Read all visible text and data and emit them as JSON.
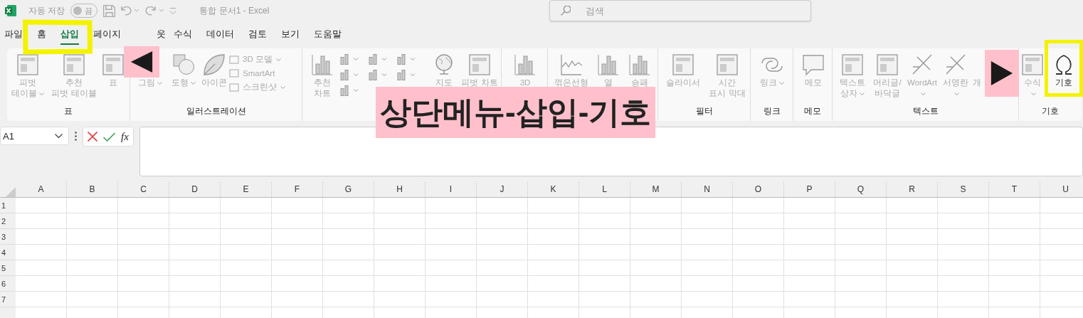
{
  "title_bar": {
    "autosave_label": "자동 저장",
    "autosave_toggle": {
      "label": "끔",
      "on": false
    },
    "document_title": "통합 문서1  -  Excel",
    "search": {
      "placeholder": "검색"
    }
  },
  "tabs": [
    {
      "label": "파일",
      "selected": false
    },
    {
      "label": "홈",
      "selected": false
    },
    {
      "label": "삽입",
      "selected": true
    },
    {
      "label": "페이지",
      "selected": false
    },
    {
      "label": "웃",
      "selected": false
    },
    {
      "label": "수식",
      "selected": false
    },
    {
      "label": "데이터",
      "selected": false
    },
    {
      "label": "검토",
      "selected": false
    },
    {
      "label": "보기",
      "selected": false
    },
    {
      "label": "도움말",
      "selected": false
    }
  ],
  "ribbon_groups": [
    {
      "label": "표",
      "items": [
        {
          "kind": "large",
          "label": "피벗\n테이블",
          "dropdown": true,
          "disabled": true
        },
        {
          "kind": "large",
          "label": "추천\n피벗 테이블",
          "dropdown": false,
          "disabled": true
        },
        {
          "kind": "large",
          "label": "표",
          "dropdown": false,
          "disabled": true
        }
      ]
    },
    {
      "label": "일러스트레이션",
      "items": [
        {
          "kind": "large",
          "label": "그림",
          "dropdown": true,
          "disabled": true
        },
        {
          "kind": "large",
          "label": "도형",
          "dropdown": true,
          "disabled": true
        },
        {
          "kind": "large",
          "label": "아이콘",
          "dropdown": false,
          "disabled": true
        },
        {
          "kind": "small",
          "label": "3D 모델",
          "dropdown": true,
          "disabled": true
        },
        {
          "kind": "small",
          "label": "SmartArt",
          "dropdown": false,
          "disabled": true
        },
        {
          "kind": "small",
          "label": "스크린샷",
          "dropdown": true,
          "disabled": true
        }
      ]
    },
    {
      "items": [
        {
          "kind": "large",
          "label": "추천\n차트",
          "dropdown": false,
          "disabled": true
        },
        {
          "kind": "chart-grid"
        },
        {
          "kind": "large",
          "label": "지도",
          "dropdown": false,
          "disabled": true
        },
        {
          "kind": "large",
          "label": "피벗 차트",
          "dropdown": false,
          "disabled": true
        }
      ]
    },
    {
      "items": [
        {
          "kind": "large",
          "label": "3D",
          "dropdown": false,
          "disabled": true
        }
      ]
    },
    {
      "items": [
        {
          "kind": "large",
          "label": "꺾은선형",
          "dropdown": false,
          "disabled": true
        },
        {
          "kind": "large",
          "label": "열",
          "dropdown": false,
          "disabled": true
        },
        {
          "kind": "large",
          "label": "승패",
          "dropdown": false,
          "disabled": true
        }
      ]
    },
    {
      "label": "필터",
      "items": [
        {
          "kind": "large",
          "label": "슬라이서",
          "dropdown": false,
          "disabled": true
        },
        {
          "kind": "large",
          "label": "시간\n표시 막대",
          "dropdown": false,
          "disabled": true
        }
      ]
    },
    {
      "label": "링크",
      "items": [
        {
          "kind": "large",
          "label": "링크",
          "dropdown": true,
          "disabled": true
        }
      ]
    },
    {
      "label": "메모",
      "items": [
        {
          "kind": "large",
          "label": "메모",
          "dropdown": false,
          "disabled": true
        }
      ]
    },
    {
      "label": "텍스트",
      "items": [
        {
          "kind": "large",
          "label": "텍스트\n상자",
          "dropdown": true,
          "disabled": true
        },
        {
          "kind": "large",
          "label": "머리글/\n바닥글",
          "dropdown": false,
          "disabled": true
        },
        {
          "kind": "large",
          "label": "WordArt",
          "dropdown": true,
          "disabled": true
        },
        {
          "kind": "large",
          "label": "서명란",
          "dropdown": true,
          "disabled": true
        },
        {
          "kind": "large",
          "label": "개",
          "dropdown": false,
          "disabled": true
        }
      ]
    },
    {
      "label": "기호",
      "items": [
        {
          "kind": "large",
          "label": "수식",
          "dropdown": true,
          "disabled": true
        },
        {
          "kind": "large",
          "label": "기호",
          "dropdown": false,
          "disabled": false
        }
      ]
    }
  ],
  "formula_bar": {
    "name_box": "A1",
    "fx": "fx"
  },
  "sheet": {
    "columns": [
      "A",
      "B",
      "C",
      "D",
      "E",
      "F",
      "G",
      "H",
      "I",
      "J",
      "K",
      "L",
      "M",
      "N",
      "O",
      "P",
      "Q",
      "R",
      "S",
      "T",
      "U"
    ],
    "rows": [
      "1",
      "2",
      "3",
      "4",
      "5",
      "6",
      "7"
    ]
  },
  "annotations": {
    "caption": "상단메뉴-삽입-기호"
  }
}
